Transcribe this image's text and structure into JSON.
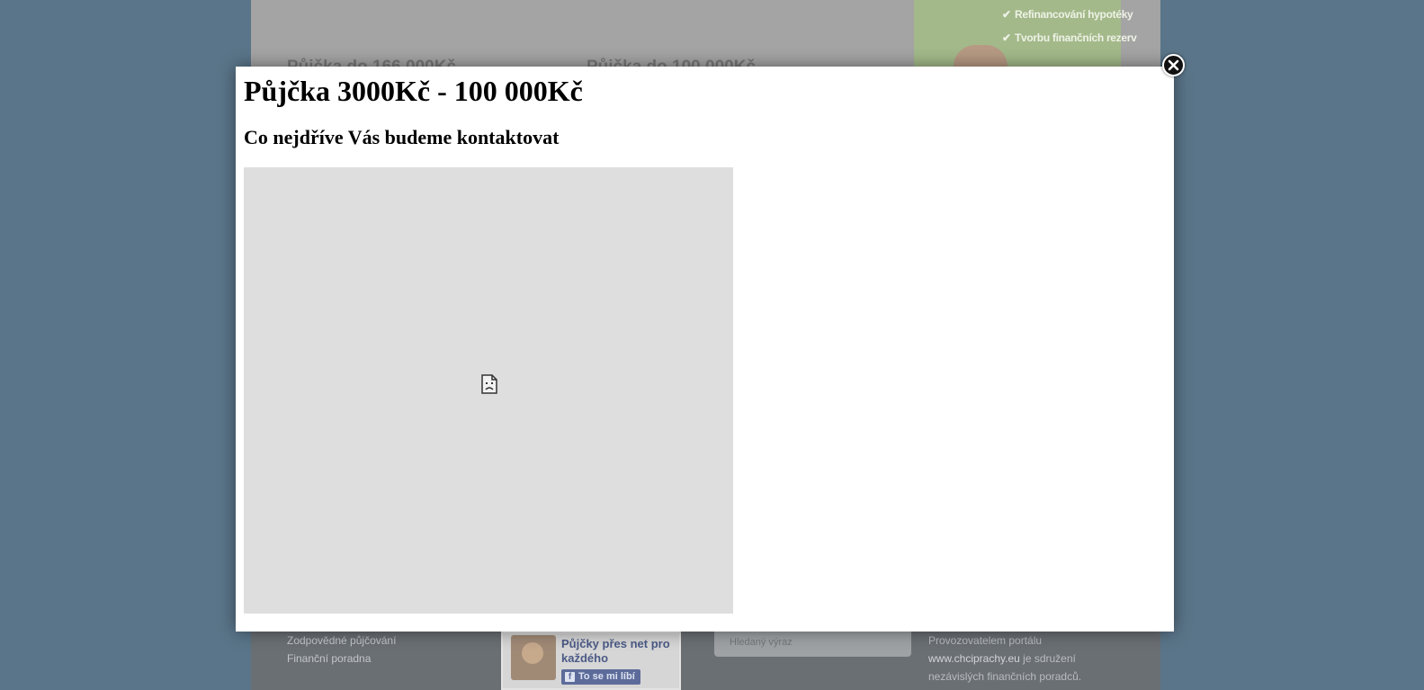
{
  "background_page": {
    "promo": {
      "items": [
        "Refinancování hypotéky",
        "Tvorbu finančních rezerv"
      ]
    },
    "loan_titles": [
      "Půjčka do 166 000Kč",
      "Půjčka do 100 000Kč"
    ],
    "footer": {
      "links": [
        "Zodpovědné půjčování",
        "Finanční poradna"
      ],
      "facebook": {
        "title": "Půjčky přes net pro každého",
        "like_label": "To se mi líbí"
      },
      "search": {
        "placeholder": "Hledaný výraz"
      },
      "about": {
        "prefix": "Provozovatelem portálu",
        "site": "www.chciprachy.eu",
        "suffix": " je sdružení nezávislých finančních poradců."
      }
    }
  },
  "modal": {
    "title": "Půjčka 3000Kč - 100 000Kč",
    "subtitle": "Co nejdříve Vás budeme kontaktovat"
  },
  "colors": {
    "backdrop": "#5a7589",
    "modal_bg": "#ffffff",
    "frame_bg": "#dedede"
  }
}
